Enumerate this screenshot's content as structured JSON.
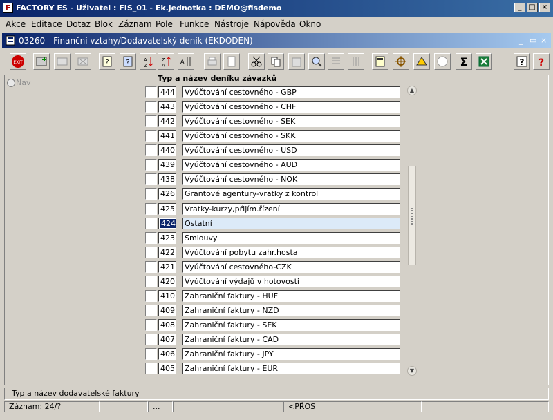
{
  "window": {
    "title": "FACTORY ES - Uživatel : FIS_01 - Ek.jednotka : DEMO@fisdemo",
    "controls": {
      "minimize": "_",
      "maximize": "□",
      "close": "×"
    }
  },
  "menu": [
    "Akce",
    "Editace",
    "Dotaz",
    "Blok",
    "Záznam",
    "Pole",
    "Funkce",
    "Nástroje",
    "Nápověda",
    "Okno"
  ],
  "form": {
    "title": "03260 - Finanční vztahy/Dodavatelský deník (EKDODEN)"
  },
  "toolbar": {
    "exit_label": "EXIT",
    "sum_label": "Σ",
    "help_label": "?"
  },
  "nav": {
    "label": "Nav"
  },
  "list": {
    "header": "Typ a název deníku závazků",
    "selected_index": 9,
    "rows": [
      {
        "code": "444",
        "name": "Vyúčtování cestovného - GBP"
      },
      {
        "code": "443",
        "name": "Vyúčtování cestovného - CHF"
      },
      {
        "code": "442",
        "name": "Vyúčtování cestovného - SEK"
      },
      {
        "code": "441",
        "name": "Vyúčtování cestovného - SKK"
      },
      {
        "code": "440",
        "name": "Vyúčtování cestovného - USD"
      },
      {
        "code": "439",
        "name": "Vyúčtování cestovného - AUD"
      },
      {
        "code": "438",
        "name": "Vyúčtování cestovného - NOK"
      },
      {
        "code": "426",
        "name": "Grantové agentury-vratky z kontrol"
      },
      {
        "code": "425",
        "name": "Vratky-kurzy,přijím.řízení"
      },
      {
        "code": "424",
        "name": "Ostatní"
      },
      {
        "code": "423",
        "name": "Smlouvy"
      },
      {
        "code": "422",
        "name": "Vyúčtování pobytu zahr.hosta"
      },
      {
        "code": "421",
        "name": "Vyúčtování cestovného-CZK"
      },
      {
        "code": "420",
        "name": "Vyúčtování výdajů v hotovosti"
      },
      {
        "code": "410",
        "name": "Zahraniční faktury - HUF"
      },
      {
        "code": "409",
        "name": "Zahraniční faktury - NZD"
      },
      {
        "code": "408",
        "name": "Zahraniční faktury - SEK"
      },
      {
        "code": "407",
        "name": "Zahraniční faktury - CAD"
      },
      {
        "code": "406",
        "name": "Zahraniční faktury - JPY"
      },
      {
        "code": "405",
        "name": "Zahraniční faktury - EUR"
      }
    ]
  },
  "status": {
    "hint": "Typ a název dodavatelské faktury",
    "record": "Záznam: 24/?",
    "ellipsis": "...",
    "mode": "<PŘOS"
  }
}
